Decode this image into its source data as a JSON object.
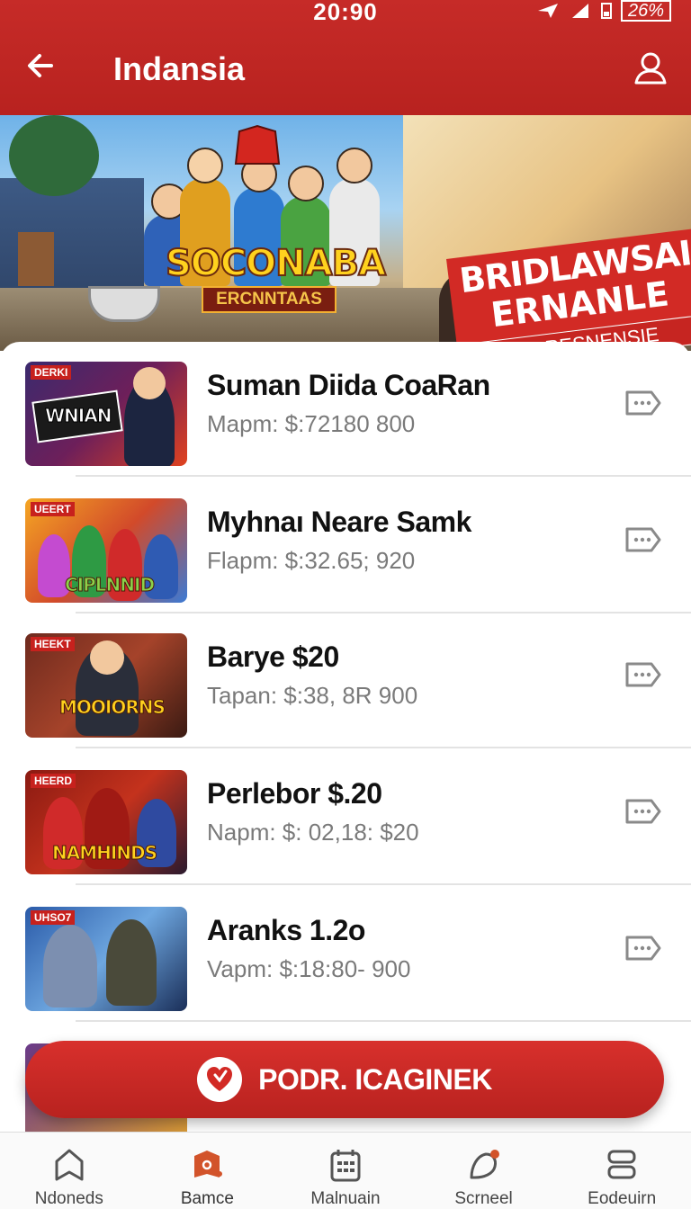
{
  "status_bar": {
    "time": "20:90",
    "battery": "26%"
  },
  "header": {
    "title": "Indansia"
  },
  "banner": {
    "logo_title": "SOCONABA",
    "logo_subtitle": "ERCNNTAAS",
    "promo_line1": "BRIDLAWSAI",
    "promo_line2": "ERNANLE",
    "promo_line3": "SENAINI RESNENSIE"
  },
  "items": [
    {
      "badge": "DERKI",
      "thumb_text": "WNIAN",
      "title": "Suman Diida CoaRan",
      "price": "Mapm: $:72180  800"
    },
    {
      "badge": "UEERT",
      "thumb_text": "CIPLNNID",
      "title": "Myhnaı Neare Samk",
      "price": "Flapm: $:32.65;  920"
    },
    {
      "badge": "HEEKT",
      "thumb_text": "MOOIORNS",
      "title": "Barye $20",
      "price": "Tapan: $:38, 8R  900"
    },
    {
      "badge": "HEERD",
      "thumb_text": "NAMHINDS",
      "title": "Perlebor $.20",
      "price": "Napm: $: 02,18:  $20"
    },
    {
      "badge": "UHSO7",
      "thumb_text": "",
      "title": "Aranks 1.2o",
      "price": "Vapm: $:18:80-  900"
    }
  ],
  "cta": {
    "label": "PODR. ICAGINEK"
  },
  "nav": [
    {
      "label": "Ndoneds"
    },
    {
      "label": "Bamce"
    },
    {
      "label": "Malnuain"
    },
    {
      "label": "Scrneel"
    },
    {
      "label": "Eodeuirn"
    }
  ],
  "colors": {
    "brand_red": "#c62b28",
    "active_nav": "#d2532a"
  }
}
